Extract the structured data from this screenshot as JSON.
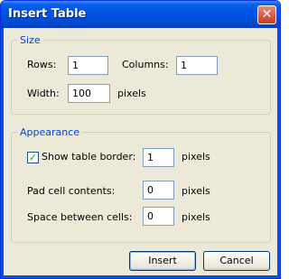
{
  "window": {
    "title": "Insert Table"
  },
  "size_group": {
    "legend": "Size",
    "rows_label": "Rows:",
    "rows_value": "1",
    "columns_label": "Columns:",
    "columns_value": "1",
    "width_label": "Width:",
    "width_value": "100",
    "width_unit": "pixels"
  },
  "appearance_group": {
    "legend": "Appearance",
    "show_border_label": "Show table border:",
    "show_border_checked": true,
    "border_value": "1",
    "border_unit": "pixels",
    "pad_label": "Pad cell contents:",
    "pad_value": "0",
    "pad_unit": "pixels",
    "spacing_label": "Space between cells:",
    "spacing_value": "0",
    "spacing_unit": "pixels"
  },
  "buttons": {
    "insert": "Insert",
    "cancel": "Cancel"
  }
}
